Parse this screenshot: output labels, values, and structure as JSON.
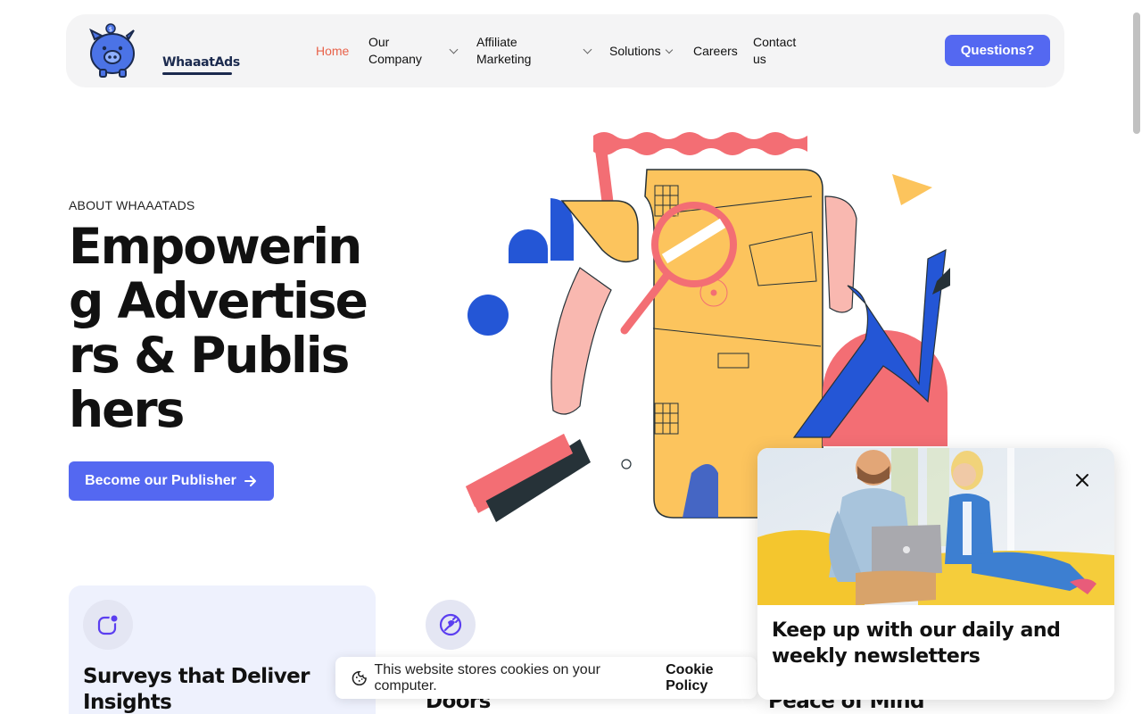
{
  "header": {
    "logo_text": "WhaaatAds",
    "nav": [
      {
        "label": "Home",
        "active": true
      },
      {
        "label": "Our Company",
        "has_dropdown": true
      },
      {
        "label": "Affiliate Marketing",
        "has_dropdown": true
      },
      {
        "label": "Solutions",
        "has_dropdown": true
      },
      {
        "label": "Careers"
      },
      {
        "label": "Contact us"
      }
    ],
    "cta_label": "Questions?"
  },
  "hero": {
    "eyebrow": "ABOUT WHAAATADS",
    "title": "Empowering Advertisers & Publishers",
    "button_label": "Become our Publisher",
    "button_icon": "arrow-right-icon"
  },
  "cards": [
    {
      "title": "Surveys that Deliver Insights",
      "icon": "notification-square-icon"
    },
    {
      "title": "Doors",
      "icon": "plug-icon"
    },
    {
      "title": "Peace of Mind"
    }
  ],
  "cookie_bar": {
    "text": "This website stores cookies on your computer.",
    "link": "Cookie Policy",
    "icon": "cookie-icon"
  },
  "newsletter_popup": {
    "title": "Keep up with our daily and weekly newsletters",
    "close_icon": "close-icon"
  },
  "colors": {
    "accent": "#5468f1",
    "active_nav": "#e8624a",
    "card_bg": "#eef1fd"
  }
}
